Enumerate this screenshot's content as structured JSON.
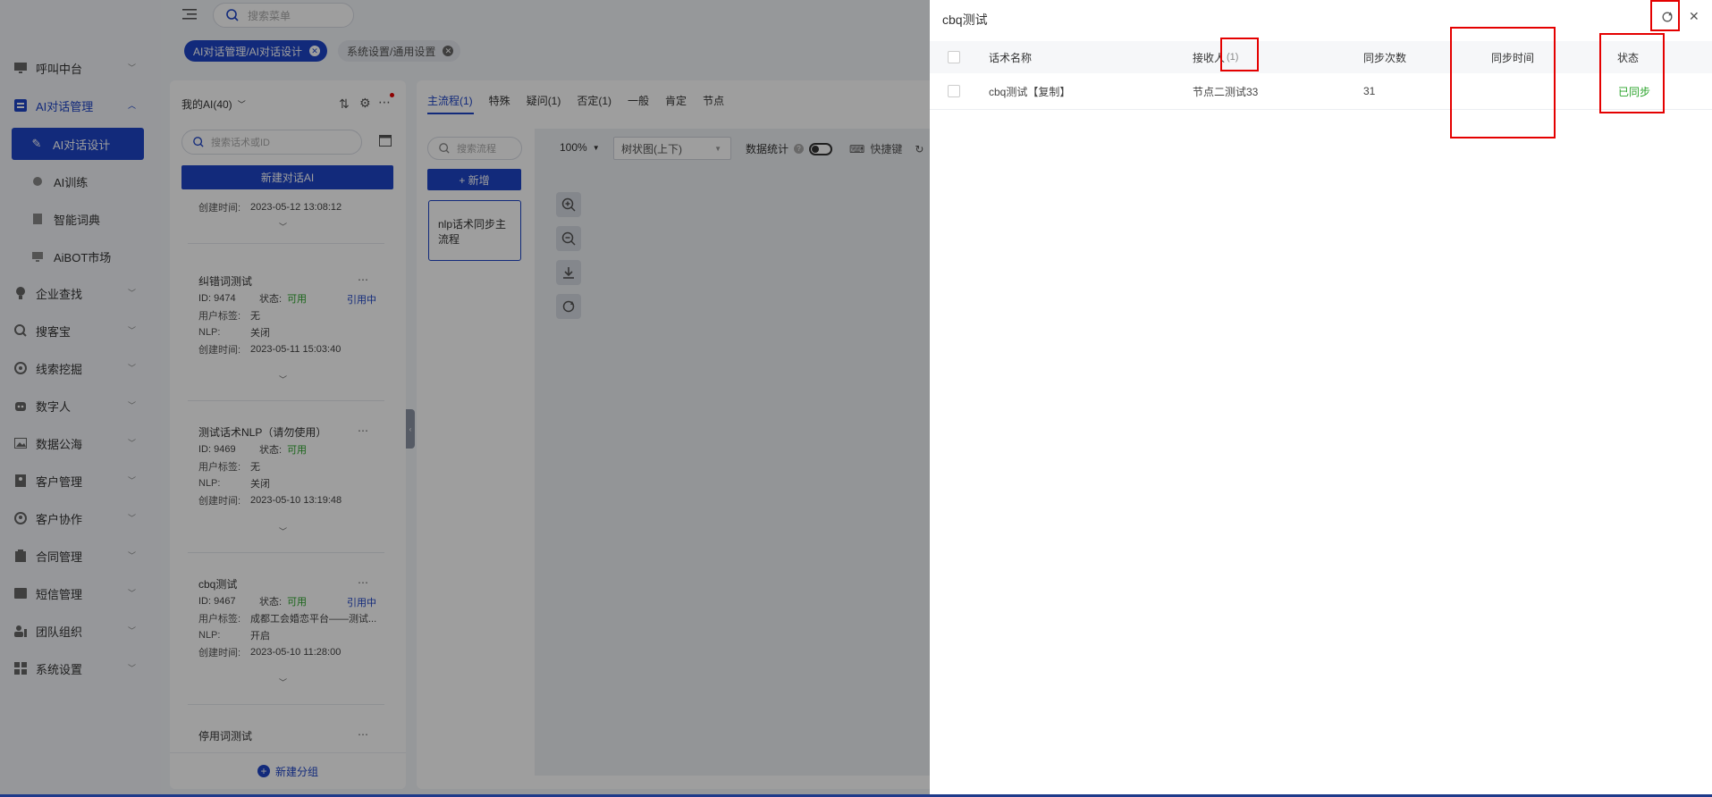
{
  "topbar": {
    "search_placeholder": "搜索菜单"
  },
  "tabs": [
    {
      "label": "AI对话管理/AI对话设计",
      "active": true
    },
    {
      "label": "系统设置/通用设置",
      "active": false
    }
  ],
  "sidebar": {
    "items": [
      {
        "label": "呼叫中台",
        "icon": "monitor-icon"
      },
      {
        "label": "AI对话管理",
        "icon": "ai-chat-icon"
      },
      {
        "label": "企业查找",
        "icon": "bulb-icon"
      },
      {
        "label": "搜客宝",
        "icon": "search-person-icon"
      },
      {
        "label": "线索挖掘",
        "icon": "target-icon"
      },
      {
        "label": "数字人",
        "icon": "robot-icon"
      },
      {
        "label": "数据公海",
        "icon": "image-icon"
      },
      {
        "label": "客户管理",
        "icon": "contacts-icon"
      },
      {
        "label": "客户协作",
        "icon": "people-icon"
      },
      {
        "label": "合同管理",
        "icon": "clipboard-icon"
      },
      {
        "label": "短信管理",
        "icon": "sms-icon"
      },
      {
        "label": "团队组织",
        "icon": "team-icon"
      },
      {
        "label": "系统设置",
        "icon": "grid-icon"
      }
    ],
    "sub_items": [
      {
        "label": "AI对话设计",
        "active": true
      },
      {
        "label": "AI训练"
      },
      {
        "label": "智能词典"
      },
      {
        "label": "AiBOT市场"
      }
    ]
  },
  "ai_list": {
    "title": "我的AI(40)",
    "search_placeholder": "搜索话术或ID",
    "new_button": "新建对话AI",
    "new_group": "新建分组",
    "first_time": {
      "key": "创建时间:",
      "value": "2023-05-12 13:08:12"
    },
    "cards": [
      {
        "name": "纠错词测试",
        "id": "ID:  9474",
        "status_key": "状态:",
        "status": "可用",
        "ref": "引用中",
        "tags_key": "用户标签:",
        "tags": "无",
        "nlp_key": "NLP:",
        "nlp": "关闭",
        "time_key": "创建时间:",
        "time": "2023-05-11 15:03:40"
      },
      {
        "name": "测试话术NLP（请勿使用）",
        "id": "ID:  9469",
        "status_key": "状态:",
        "status": "可用",
        "ref": "",
        "tags_key": "用户标签:",
        "tags": "无",
        "nlp_key": "NLP:",
        "nlp": "关闭",
        "time_key": "创建时间:",
        "time": "2023-05-10 13:19:48"
      },
      {
        "name": "cbq测试",
        "id": "ID:  9467",
        "status_key": "状态:",
        "status": "可用",
        "ref": "引用中",
        "tags_key": "用户标签:",
        "tags": "成都工会婚恋平台——测试...",
        "nlp_key": "NLP:",
        "nlp": "开启",
        "time_key": "创建时间:",
        "time": "2023-05-10 11:28:00"
      },
      {
        "name": "停用词测试",
        "id": "",
        "status_key": "",
        "status": "",
        "ref": "",
        "tags_key": "",
        "tags": "",
        "nlp_key": "",
        "nlp": "",
        "time_key": "",
        "time": ""
      }
    ]
  },
  "flow_tabs": [
    "主流程(1)",
    "特殊",
    "疑问(1)",
    "否定(1)",
    "一般",
    "肯定",
    "节点"
  ],
  "flow": {
    "search_placeholder": "搜索流程",
    "add_button": "+ 新增",
    "item": "nlp话术同步主流程",
    "zoom": "100%",
    "layout": "树状图(上下)",
    "stats_label": "数据统计",
    "shortcut": "快捷键"
  },
  "drawer": {
    "title": "cbq测试",
    "columns": [
      "话术名称",
      "接收人",
      "(1)",
      "同步次数",
      "同步时间",
      "状态"
    ],
    "rows": [
      {
        "name": "cbq测试【复制】",
        "receiver": "节点二测试33",
        "count": "31",
        "time": "",
        "status": "已同步"
      }
    ]
  },
  "colors": {
    "primary": "#1e44c7",
    "success": "#2aa32a",
    "highlight": "#e40000"
  }
}
